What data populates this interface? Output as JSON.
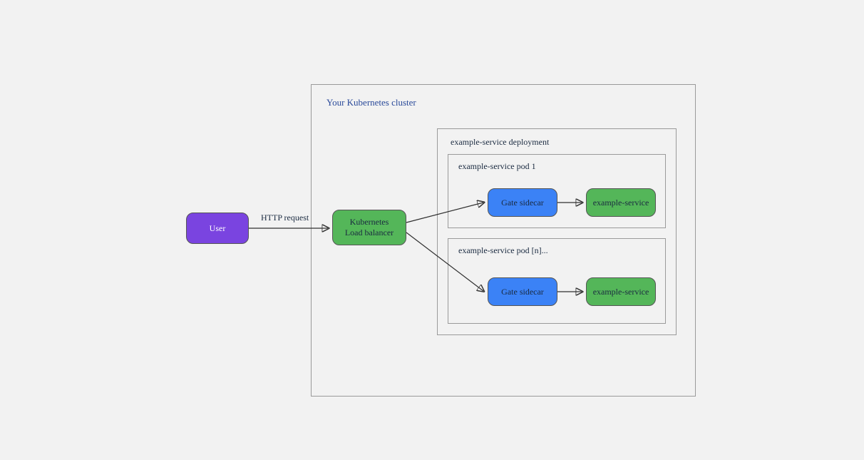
{
  "diagram": {
    "cluster_title": "Your Kubernetes cluster",
    "deployment_title": "example-service deployment",
    "pods": [
      {
        "title": "example-service pod 1",
        "sidecar": "Gate sidecar",
        "service": "example-service"
      },
      {
        "title": "example-service pod [n]...",
        "sidecar": "Gate sidecar",
        "service": "example-service"
      }
    ],
    "user_label": "User",
    "load_balancer_label_line1": "Kubernetes",
    "load_balancer_label_line2": "Load balancer",
    "edge_http_label": "HTTP request"
  },
  "colors": {
    "user_bg": "#7a44e0",
    "green_bg": "#54b659",
    "blue_bg": "#3b82f6",
    "border": "#555555",
    "container_border": "#9a9a9a",
    "title_color": "#2a4a9a"
  }
}
